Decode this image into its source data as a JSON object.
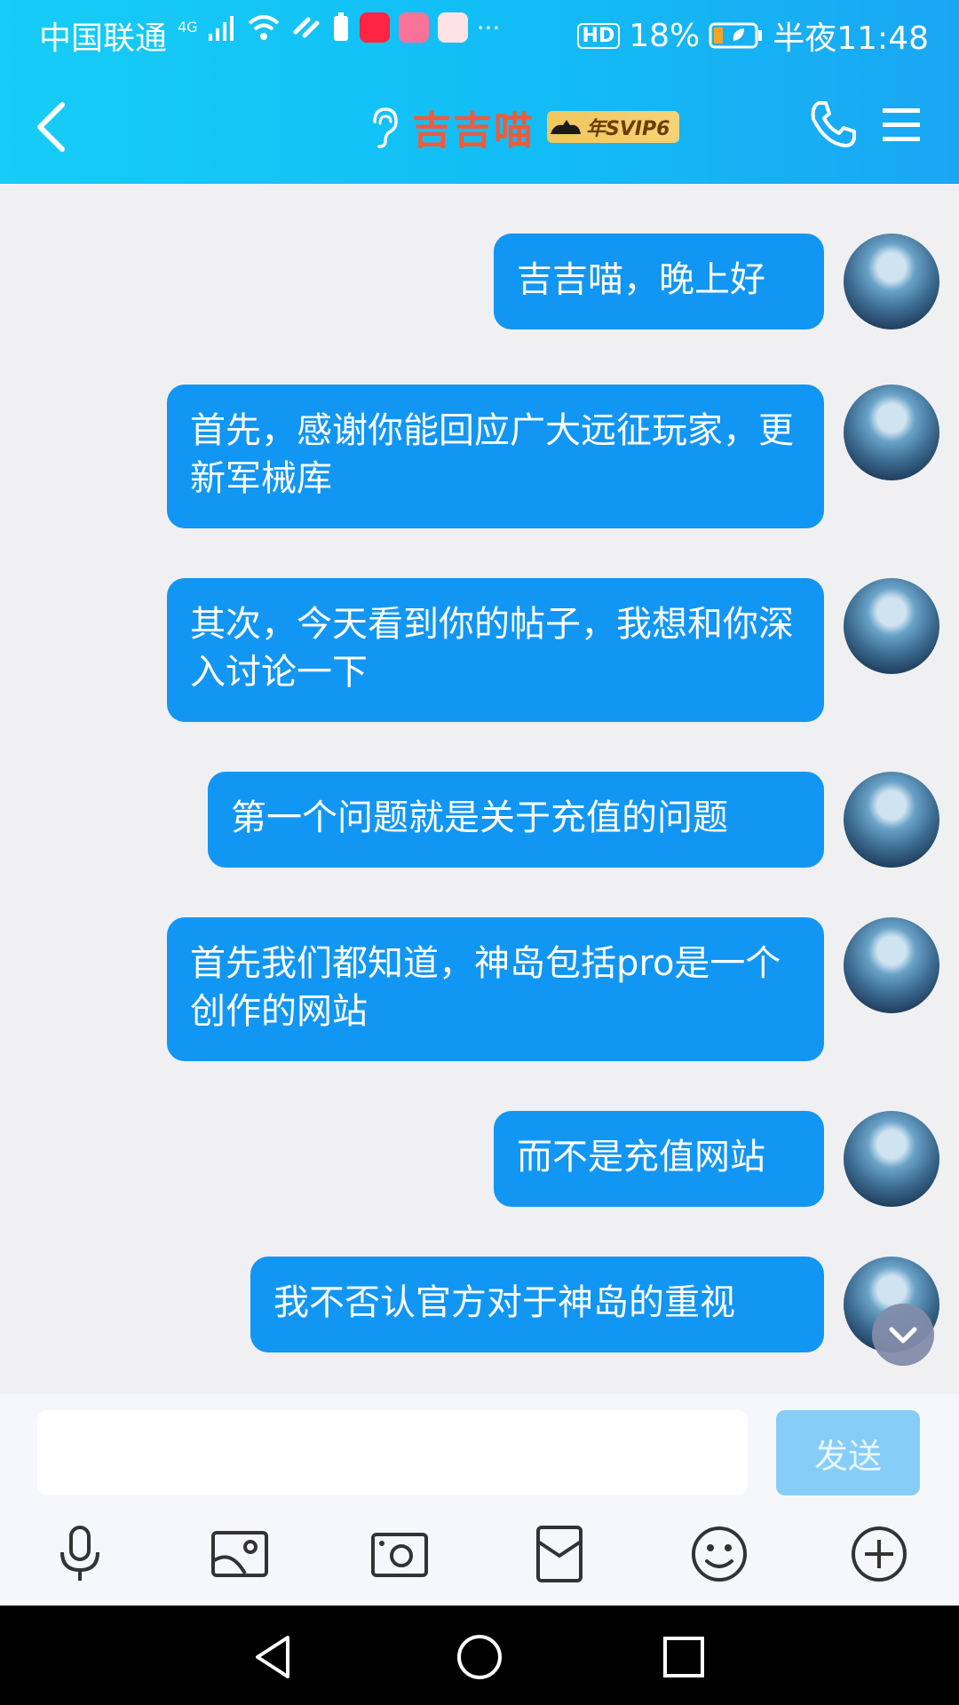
{
  "status_bar": {
    "carrier": "中国联通",
    "network": "4G",
    "hd": "HD",
    "battery": "18%",
    "time": "半夜11:48",
    "more": "···"
  },
  "header": {
    "contact_name": "吉吉喵",
    "badge": "年SVIP6",
    "title_color": "#ef5a3a"
  },
  "messages": [
    {
      "text": "吉吉喵，晚上好"
    },
    {
      "text": "首先，感谢你能回应广大远征玩家，更新军械库"
    },
    {
      "text": "其次，今天看到你的帖子，我想和你深入讨论一下"
    },
    {
      "text": "第一个问题就是关于充值的问题"
    },
    {
      "text": "首先我们都知道，神岛包括pro是一个创作的网站"
    },
    {
      "text": "而不是充值网站"
    },
    {
      "text": "我不否认官方对于神岛的重视"
    }
  ],
  "input": {
    "value": "",
    "send_label": "发送"
  },
  "toolbar": {
    "items": [
      "microphone-icon",
      "picture-icon",
      "camera-icon",
      "red-packet-icon",
      "emoji-icon",
      "plus-icon"
    ]
  },
  "nav": {
    "items": [
      "back-triangle-icon",
      "home-circle-icon",
      "recents-square-icon"
    ]
  },
  "colors": {
    "header_start": "#16cdf7",
    "header_end": "#1aa6f3",
    "bubble": "#1296f3",
    "send_disabled": "#86cdf8"
  }
}
